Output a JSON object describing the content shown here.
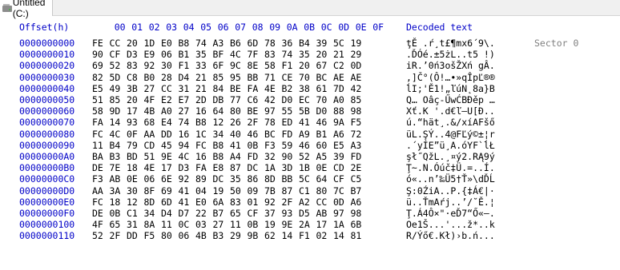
{
  "tab": {
    "title": "Untitled (C:)",
    "icon": "disk-drive-icon"
  },
  "header": {
    "offset_label": "Offset(h)",
    "columns": [
      "00",
      "01",
      "02",
      "03",
      "04",
      "05",
      "06",
      "07",
      "08",
      "09",
      "0A",
      "0B",
      "0C",
      "0D",
      "0E",
      "0F"
    ],
    "decoded_label": "Decoded text"
  },
  "rows": [
    {
      "offset": "0000000000",
      "hex": [
        "FE",
        "CC",
        "20",
        "1D",
        "E0",
        "B8",
        "74",
        "A3",
        "B6",
        "6D",
        "78",
        "36",
        "B4",
        "39",
        "5C",
        "19"
      ],
      "text": "ţĚ .ŕ¸t£¶mx6´9\\.",
      "note": "Sector 0"
    },
    {
      "offset": "0000000010",
      "hex": [
        "90",
        "CF",
        "D3",
        "E9",
        "06",
        "B1",
        "35",
        "BF",
        "4C",
        "7F",
        "83",
        "74",
        "35",
        "20",
        "21",
        "29"
      ],
      "text": ".ĎÓé.±5żL..t5 !)"
    },
    {
      "offset": "0000000020",
      "hex": [
        "69",
        "52",
        "83",
        "92",
        "30",
        "F1",
        "33",
        "6F",
        "9C",
        "8E",
        "58",
        "F1",
        "20",
        "67",
        "C2",
        "0D"
      ],
      "text": "iR.’0ń3ošŽXń gÂ."
    },
    {
      "offset": "0000000030",
      "hex": [
        "82",
        "5D",
        "C8",
        "B0",
        "28",
        "D4",
        "21",
        "85",
        "95",
        "BB",
        "71",
        "CE",
        "70",
        "BC",
        "AE",
        "AE"
      ],
      "text": ",]Č°(Ô!…•»qÎpĽ®®"
    },
    {
      "offset": "0000000040",
      "hex": [
        "E5",
        "49",
        "3B",
        "27",
        "CC",
        "31",
        "21",
        "84",
        "BE",
        "FA",
        "4E",
        "B2",
        "38",
        "61",
        "7D",
        "42"
      ],
      "text": "ĺI;'Ě1!„ľúN˛8a}B"
    },
    {
      "offset": "0000000050",
      "hex": [
        "51",
        "85",
        "20",
        "4F",
        "E2",
        "E7",
        "2D",
        "DB",
        "77",
        "C6",
        "42",
        "D0",
        "EC",
        "70",
        "A0",
        "85"
      ],
      "text": "Q… Oâç-ŰwĆBĐěp …"
    },
    {
      "offset": "0000000060",
      "hex": [
        "58",
        "9D",
        "17",
        "4B",
        "A0",
        "27",
        "16",
        "64",
        "80",
        "BE",
        "97",
        "55",
        "5B",
        "D0",
        "88",
        "98"
      ],
      "text": "Xť.K '.d€ľ—U[Đ.."
    },
    {
      "offset": "0000000070",
      "hex": [
        "FA",
        "14",
        "93",
        "68",
        "E4",
        "74",
        "B8",
        "12",
        "26",
        "2F",
        "78",
        "ED",
        "41",
        "46",
        "9A",
        "F5"
      ],
      "text": "ú.“hät¸.&/xíAFšő"
    },
    {
      "offset": "0000000080",
      "hex": [
        "FC",
        "4C",
        "0F",
        "AA",
        "DD",
        "16",
        "1C",
        "34",
        "40",
        "46",
        "BC",
        "FD",
        "A9",
        "B1",
        "A6",
        "72"
      ],
      "text": "üL.ŞÝ..4@FĽý©±¦r"
    },
    {
      "offset": "0000000090",
      "hex": [
        "11",
        "B4",
        "79",
        "CD",
        "45",
        "94",
        "FC",
        "B8",
        "41",
        "0B",
        "F3",
        "59",
        "46",
        "60",
        "E5",
        "A3"
      ],
      "text": ".´yÍE”ü¸A.óYF`ĺŁ"
    },
    {
      "offset": "00000000A0",
      "hex": [
        "BA",
        "B3",
        "BD",
        "51",
        "9E",
        "4C",
        "16",
        "B8",
        "A4",
        "FD",
        "32",
        "90",
        "52",
        "A5",
        "39",
        "FD"
      ],
      "text": "şł˝QžL.¸¤ý2.RĄ9ý"
    },
    {
      "offset": "00000000B0",
      "hex": [
        "DE",
        "7E",
        "18",
        "4E",
        "17",
        "D3",
        "FA",
        "E8",
        "87",
        "DC",
        "1A",
        "3D",
        "1B",
        "0E",
        "CD",
        "2E"
      ],
      "text": "Ţ~.N.Óúč‡Ü.=..Í."
    },
    {
      "offset": "00000000C0",
      "hex": [
        "F3",
        "AB",
        "0E",
        "06",
        "6E",
        "92",
        "89",
        "DC",
        "35",
        "86",
        "8D",
        "BB",
        "5C",
        "64",
        "CF",
        "C5"
      ],
      "text": "ó«..n’‰Ü5†Ť»\\dĎĹ"
    },
    {
      "offset": "00000000D0",
      "hex": [
        "AA",
        "3A",
        "30",
        "8F",
        "69",
        "41",
        "04",
        "19",
        "50",
        "09",
        "7B",
        "87",
        "C1",
        "80",
        "7C",
        "B7"
      ],
      "text": "Ş:0ŹiA..P.{‡Á€|·"
    },
    {
      "offset": "00000000E0",
      "hex": [
        "FC",
        "18",
        "12",
        "8D",
        "6D",
        "41",
        "E0",
        "6A",
        "83",
        "01",
        "92",
        "2F",
        "A2",
        "CC",
        "0D",
        "A6"
      ],
      "text": "ü..ŤmAŕj..’/˘Ě.¦"
    },
    {
      "offset": "00000000F0",
      "hex": [
        "DE",
        "0B",
        "C1",
        "34",
        "D4",
        "D7",
        "22",
        "B7",
        "65",
        "CF",
        "37",
        "93",
        "D5",
        "AB",
        "97",
        "98"
      ],
      "text": "Ţ.Á4Ô×\"·eĎ7“Ő«—."
    },
    {
      "offset": "0000000100",
      "hex": [
        "4F",
        "65",
        "31",
        "8A",
        "11",
        "0C",
        "03",
        "27",
        "11",
        "0B",
        "19",
        "9E",
        "2A",
        "17",
        "1A",
        "6B"
      ],
      "text": "Oe1Š...'...ž*..k"
    },
    {
      "offset": "0000000110",
      "hex": [
        "52",
        "2F",
        "DD",
        "F5",
        "80",
        "06",
        "4B",
        "B3",
        "29",
        "9B",
        "62",
        "14",
        "F1",
        "02",
        "14",
        "81"
      ],
      "text": "R/Ýő€.Kł)›b.ń..."
    }
  ],
  "colors": {
    "offset": "#0000c8",
    "header": "#0000c8",
    "sector_note": "#808080"
  }
}
